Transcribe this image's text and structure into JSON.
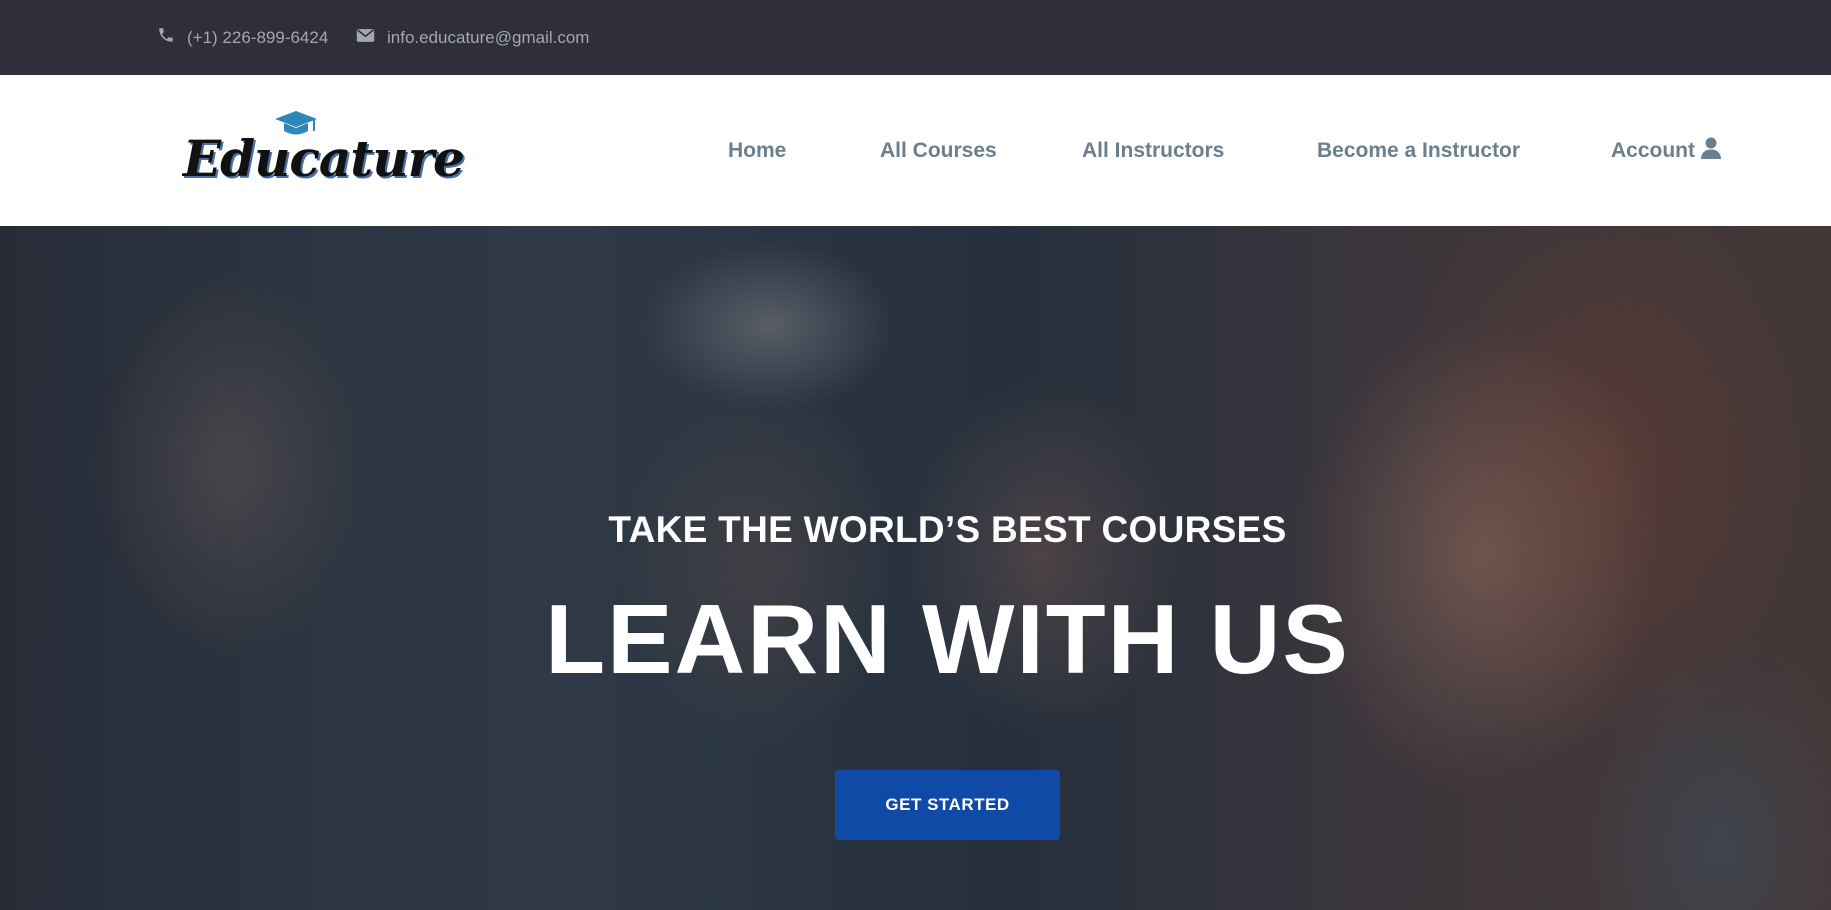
{
  "topbar": {
    "phone": "(+1) 226-899-6424",
    "email": "info.educature@gmail.com",
    "phone_icon": "phone-icon",
    "email_icon": "envelope-icon"
  },
  "header": {
    "logo_text": "Educature",
    "logo_icon": "graduation-cap-icon",
    "nav": {
      "home": "Home",
      "all_courses": "All Courses",
      "all_instructors": "All Instructors",
      "become_instructor": "Become a Instructor",
      "account": "Account"
    },
    "account_icon": "user-icon"
  },
  "hero": {
    "subtitle": "TAKE THE WORLD’S BEST COURSES",
    "title": "LEARN WITH US",
    "cta": "GET STARTED"
  },
  "colors": {
    "topbar_bg": "#2e2f3b",
    "nav_text": "#6b7f8f",
    "cta_bg": "#0f4aa6",
    "logo_accent": "#2f86b8"
  }
}
